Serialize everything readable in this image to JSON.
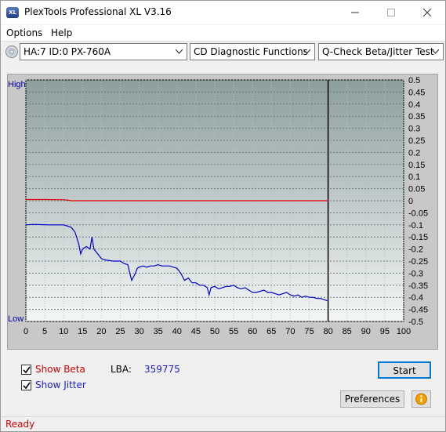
{
  "window": {
    "title": "PlexTools Professional XL V3.16",
    "app_icon_text": "XL"
  },
  "menu": {
    "options": "Options",
    "help": "Help"
  },
  "toolbar": {
    "drive": "HA:7 ID:0  PX-760A",
    "function": "CD Diagnostic Functions",
    "test": "Q-Check Beta/Jitter Test"
  },
  "chart_data": {
    "type": "line",
    "left_axis": {
      "top_label": "High",
      "bottom_label": "Low"
    },
    "x_ticks": [
      "0",
      "5",
      "10",
      "15",
      "20",
      "25",
      "30",
      "35",
      "40",
      "45",
      "50",
      "55",
      "60",
      "65",
      "70",
      "75",
      "80",
      "85",
      "90",
      "95",
      "100"
    ],
    "y_ticks": [
      "0.5",
      "0.45",
      "0.4",
      "0.35",
      "0.3",
      "0.25",
      "0.2",
      "0.15",
      "0.1",
      "0.05",
      "0",
      "-0.05",
      "-0.1",
      "-0.15",
      "-0.2",
      "-0.25",
      "-0.3",
      "-0.35",
      "-0.4",
      "-0.45",
      "-0.5"
    ],
    "xlim": [
      0,
      100
    ],
    "ylim": [
      -0.5,
      0.5
    ],
    "test_end_x": 80,
    "grid": true,
    "colors": {
      "beta": "#e00000",
      "jitter": "#0000c8",
      "plot_bg_top": "#8c9e9e",
      "plot_bg_bottom": "#f4f6f6",
      "unused_bg": "#c8c8c8"
    },
    "series": [
      {
        "name": "Beta",
        "x": [
          0,
          5,
          10,
          11,
          12,
          20,
          40,
          60,
          80
        ],
        "y": [
          0.005,
          0.005,
          0.004,
          0.003,
          0.0,
          0.0,
          0.0,
          0.0,
          0.0
        ]
      },
      {
        "name": "Jitter",
        "x": [
          0,
          2,
          4,
          6,
          8,
          10,
          11,
          12,
          13,
          14,
          14.5,
          15,
          16,
          17,
          17.5,
          18,
          19,
          20,
          21,
          23,
          25,
          26,
          27,
          27.5,
          28,
          29,
          29.5,
          30,
          31,
          32,
          33,
          34,
          35,
          36,
          37,
          38,
          39,
          40,
          41,
          42,
          43,
          44,
          45,
          46,
          47,
          48,
          48.5,
          49,
          50,
          51,
          52,
          53,
          54,
          55,
          56,
          57,
          58,
          59,
          60,
          61,
          62,
          63,
          64,
          65,
          66,
          67,
          68,
          69,
          70,
          71,
          72,
          73,
          74,
          75,
          76,
          77,
          78,
          79,
          80
        ],
        "y": [
          -0.1,
          -0.098,
          -0.099,
          -0.1,
          -0.1,
          -0.1,
          -0.105,
          -0.11,
          -0.13,
          -0.18,
          -0.22,
          -0.2,
          -0.19,
          -0.2,
          -0.15,
          -0.2,
          -0.22,
          -0.24,
          -0.245,
          -0.25,
          -0.25,
          -0.26,
          -0.265,
          -0.3,
          -0.33,
          -0.3,
          -0.28,
          -0.275,
          -0.27,
          -0.275,
          -0.27,
          -0.27,
          -0.265,
          -0.27,
          -0.27,
          -0.27,
          -0.275,
          -0.28,
          -0.3,
          -0.33,
          -0.32,
          -0.34,
          -0.34,
          -0.35,
          -0.35,
          -0.36,
          -0.39,
          -0.36,
          -0.355,
          -0.365,
          -0.36,
          -0.355,
          -0.355,
          -0.35,
          -0.36,
          -0.365,
          -0.36,
          -0.37,
          -0.38,
          -0.38,
          -0.375,
          -0.37,
          -0.38,
          -0.38,
          -0.385,
          -0.39,
          -0.385,
          -0.38,
          -0.39,
          -0.395,
          -0.39,
          -0.4,
          -0.395,
          -0.4,
          -0.4,
          -0.405,
          -0.405,
          -0.41,
          -0.415
        ]
      }
    ]
  },
  "options": {
    "show_beta_label": "Show Beta",
    "show_beta_checked": true,
    "show_jitter_label": "Show Jitter",
    "show_jitter_checked": true,
    "lba_label": "LBA:",
    "lba_value": "359775"
  },
  "buttons": {
    "start": "Start",
    "preferences": "Preferences",
    "info_icon": "info-icon"
  },
  "status": {
    "text": "Ready"
  }
}
